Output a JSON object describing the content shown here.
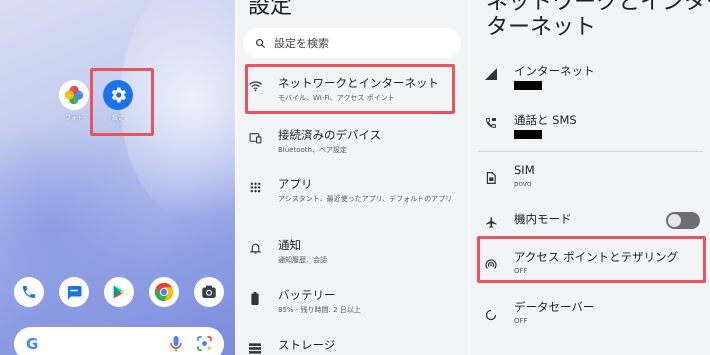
{
  "home": {
    "apps": [
      {
        "label": "フォト",
        "icon": "google-photos-icon"
      },
      {
        "label": "設定",
        "icon": "settings-gear-icon"
      }
    ],
    "dock": [
      "phone-icon",
      "messages-icon",
      "play-store-icon",
      "chrome-icon",
      "camera-icon"
    ],
    "search_bar": {
      "g": "G",
      "mic_icon": "mic-icon",
      "lens_icon": "lens-icon"
    }
  },
  "settings": {
    "title": "設定",
    "search_placeholder": "設定を検索",
    "items": [
      {
        "title": "ネットワークとインターネット",
        "subtitle": "モバイル、Wi-Fi、アクセス ポイント",
        "icon": "wifi-icon"
      },
      {
        "title": "接続済みのデバイス",
        "subtitle": "Bluetooth、ペア設定",
        "icon": "devices-icon"
      },
      {
        "title": "アプリ",
        "subtitle": "アシスタント、最近使ったアプリ、デフォルトのアプリ",
        "icon": "apps-grid-icon"
      },
      {
        "title": "通知",
        "subtitle": "通知履歴、会話",
        "icon": "bell-icon"
      },
      {
        "title": "バッテリー",
        "subtitle": "85% - 残り時間: 2 日以上",
        "icon": "battery-icon"
      },
      {
        "title": "ストレージ",
        "subtitle": "",
        "icon": "storage-icon"
      }
    ]
  },
  "network": {
    "title_line1": "ネットワークとインター",
    "title_line2": "ターネット",
    "items": [
      {
        "title": "インターネット",
        "subtitle": "",
        "icon": "signal-icon"
      },
      {
        "title": "通話と SMS",
        "subtitle": "",
        "icon": "call-sms-icon"
      },
      {
        "title": "SIM",
        "subtitle": "povo",
        "icon": "sim-icon"
      },
      {
        "title": "機内モード",
        "subtitle": "",
        "icon": "airplane-icon",
        "toggle": "off"
      },
      {
        "title": "アクセス ポイントとテザリング",
        "subtitle": "OFF",
        "icon": "hotspot-icon"
      },
      {
        "title": "データセーバー",
        "subtitle": "OFF",
        "icon": "data-saver-icon"
      }
    ]
  },
  "colors": {
    "highlight": "#e8545f",
    "settings_bg": "#f3f4f6",
    "google_blue": "#1a73e8"
  }
}
